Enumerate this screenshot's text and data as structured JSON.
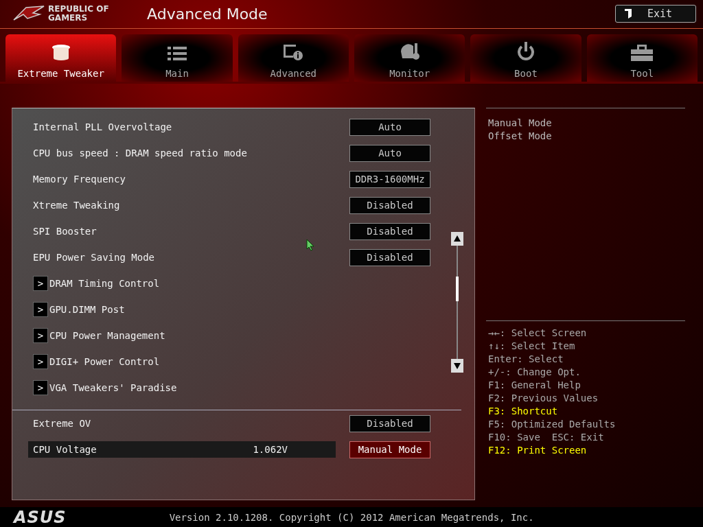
{
  "header": {
    "brand": "REPUBLIC OF GAMERS",
    "title": "Advanced Mode",
    "exit_button": "Exit"
  },
  "tabs": [
    {
      "label": "Extreme Tweaker",
      "kind": "tweaker",
      "selected": true
    },
    {
      "label": "Main",
      "kind": "list",
      "selected": false
    },
    {
      "label": "Advanced",
      "kind": "info",
      "selected": false
    },
    {
      "label": "Monitor",
      "kind": "gauge",
      "selected": false
    },
    {
      "label": "Boot",
      "kind": "power",
      "selected": false
    },
    {
      "label": "Tool",
      "kind": "toolbox",
      "selected": false
    }
  ],
  "settings": [
    {
      "kind": "option",
      "label": "Internal PLL Overvoltage",
      "value": "Auto"
    },
    {
      "kind": "option",
      "label": "CPU bus speed : DRAM speed ratio mode",
      "value": "Auto"
    },
    {
      "kind": "option",
      "label": "Memory Frequency",
      "value": "DDR3-1600MHz"
    },
    {
      "kind": "option",
      "label": "Xtreme Tweaking",
      "value": "Disabled"
    },
    {
      "kind": "option",
      "label": "SPI Booster",
      "value": "Disabled"
    },
    {
      "kind": "option",
      "label": "EPU Power Saving Mode",
      "value": "Disabled"
    },
    {
      "kind": "submenu",
      "label": "DRAM Timing Control",
      "arrow": ">"
    },
    {
      "kind": "submenu",
      "label": "GPU.DIMM Post",
      "arrow": ">"
    },
    {
      "kind": "submenu",
      "label": "CPU Power Management",
      "arrow": ">"
    },
    {
      "kind": "submenu",
      "label": "DIGI+ Power Control",
      "arrow": ">"
    },
    {
      "kind": "submenu",
      "label": "VGA Tweakers' Paradise",
      "arrow": ">"
    },
    {
      "kind": "divider"
    },
    {
      "kind": "option",
      "label": "Extreme OV",
      "value": "Disabled"
    },
    {
      "kind": "voltage",
      "label": "CPU Voltage",
      "reading": "1.062V",
      "value": "Manual Mode",
      "selected": true
    }
  ],
  "help_panel": {
    "options": [
      "Manual Mode",
      "Offset Mode"
    ]
  },
  "keys": [
    {
      "text": "→←: Select Screen",
      "highlight": false
    },
    {
      "text": "↑↓: Select Item",
      "highlight": false
    },
    {
      "text": "Enter: Select",
      "highlight": false
    },
    {
      "text": "+/-: Change Opt.",
      "highlight": false
    },
    {
      "text": "F1: General Help",
      "highlight": false
    },
    {
      "text": "F2: Previous Values",
      "highlight": false
    },
    {
      "text": "F3: Shortcut",
      "highlight": true
    },
    {
      "text": "F5: Optimized Defaults",
      "highlight": false
    },
    {
      "text": "F10: Save  ESC: Exit",
      "highlight": false
    },
    {
      "text": "F12: Print Screen",
      "highlight": true
    }
  ],
  "footer": {
    "logo": "ASUS",
    "version": "Version 2.10.1208. Copyright (C) 2012 American Megatrends, Inc."
  }
}
